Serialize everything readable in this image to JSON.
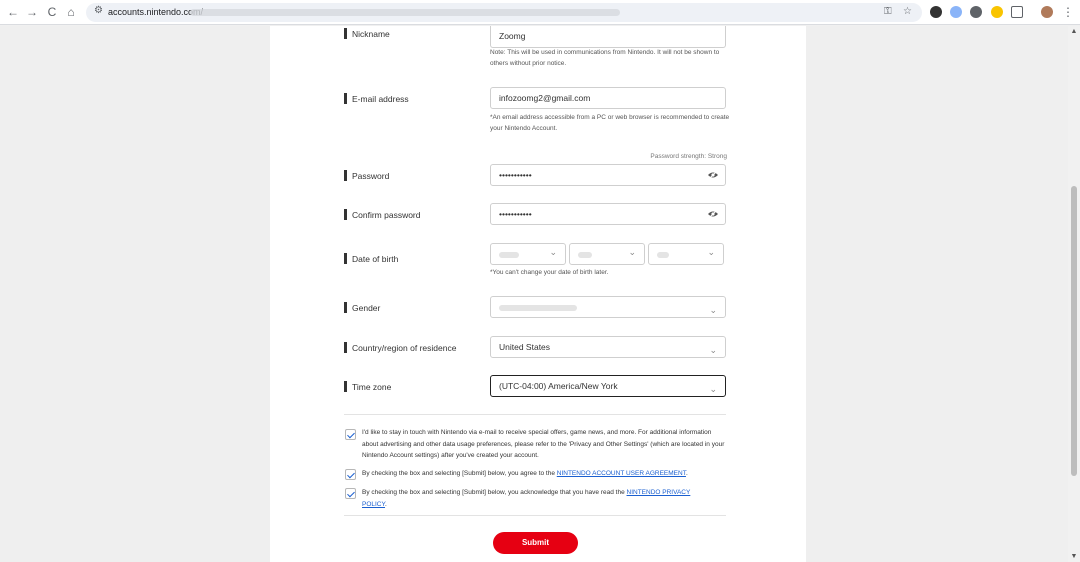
{
  "browser": {
    "url": "accounts.nintendo.com/",
    "nav": {
      "back": "←",
      "forward": "→",
      "reload": "C",
      "home": "⌂"
    }
  },
  "form": {
    "nickname": {
      "label": "Nickname",
      "value": "Zoomg",
      "note": "Note: This will be used in communications from Nintendo. It will not be shown to others without prior notice."
    },
    "email": {
      "label": "E-mail address",
      "value": "infozoomg2@gmail.com",
      "note": "*An email address accessible from a PC or web browser is recommended to create your Nintendo Account."
    },
    "password_strength": "Password strength: Strong",
    "password": {
      "label": "Password",
      "value": "•••••••••••"
    },
    "confirm_password": {
      "label": "Confirm password",
      "value": "•••••••••••"
    },
    "date_of_birth": {
      "label": "Date of birth",
      "note": "*You can't change your date of birth later."
    },
    "gender": {
      "label": "Gender"
    },
    "country": {
      "label": "Country/region of residence",
      "value": "United States"
    },
    "timezone": {
      "label": "Time zone",
      "value": "(UTC-04:00) America/New York"
    },
    "consents": [
      {
        "text": "I'd like to stay in touch with Nintendo via e-mail to receive special offers, game news, and more. For additional information about advertising and other data usage preferences, please refer to the 'Privacy and Other Settings' (which are located in your Nintendo Account settings) after you've created your account.",
        "checked": true
      },
      {
        "text_before": "By checking the box and selecting [Submit] below, you agree to the ",
        "link": "NINTENDO ACCOUNT USER AGREEMENT",
        "text_after": ".",
        "checked": true
      },
      {
        "text_before": "By checking the box and selecting [Submit] below, you acknowledge that you have read the ",
        "link": "NINTENDO PRIVACY POLICY",
        "text_after": ".",
        "checked": true
      }
    ],
    "submit_label": "Submit"
  },
  "colors": {
    "accent": "#e60012",
    "link": "#1a5fd0"
  }
}
